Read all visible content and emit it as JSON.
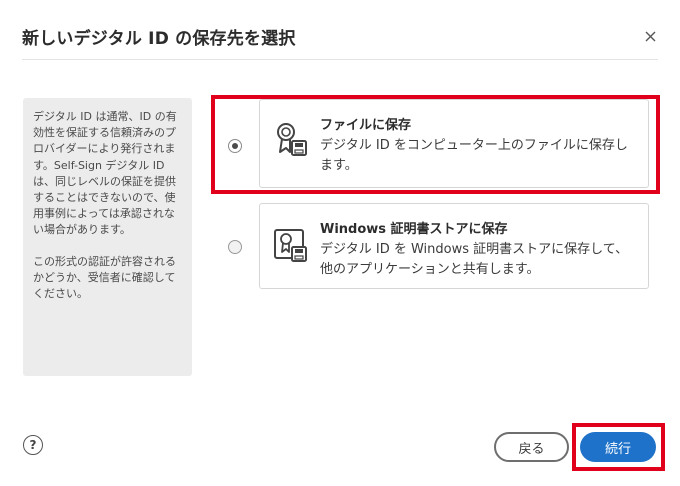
{
  "dialog": {
    "title": "新しいデジタル ID の保存先を選択",
    "close_icon": "close-icon"
  },
  "info": {
    "paragraph1": "デジタル ID は通常、ID の有効性を保証する信頼済みのプロバイダーにより発行されます。Self-Sign デジタル ID は、同じレベルの保証を提供することはできないので、使用事例によっては承認されない場合があります。",
    "paragraph2": "この形式の認証が許容されるかどうか、受信者に確認してください。"
  },
  "options": [
    {
      "title": "ファイルに保存",
      "description": "デジタル ID をコンピューター上のファイルに保存します。",
      "selected": true,
      "icon": "certificate-save-icon"
    },
    {
      "title": "Windows 証明書ストアに保存",
      "description": "デジタル ID を Windows 証明書ストアに保存して、他のアプリケーションと共有します。",
      "selected": false,
      "icon": "certificate-store-icon"
    }
  ],
  "footer": {
    "help_glyph": "?",
    "back_label": "戻る",
    "continue_label": "続行"
  },
  "colors": {
    "accent": "#1f72c9",
    "highlight": "#e0001b"
  }
}
